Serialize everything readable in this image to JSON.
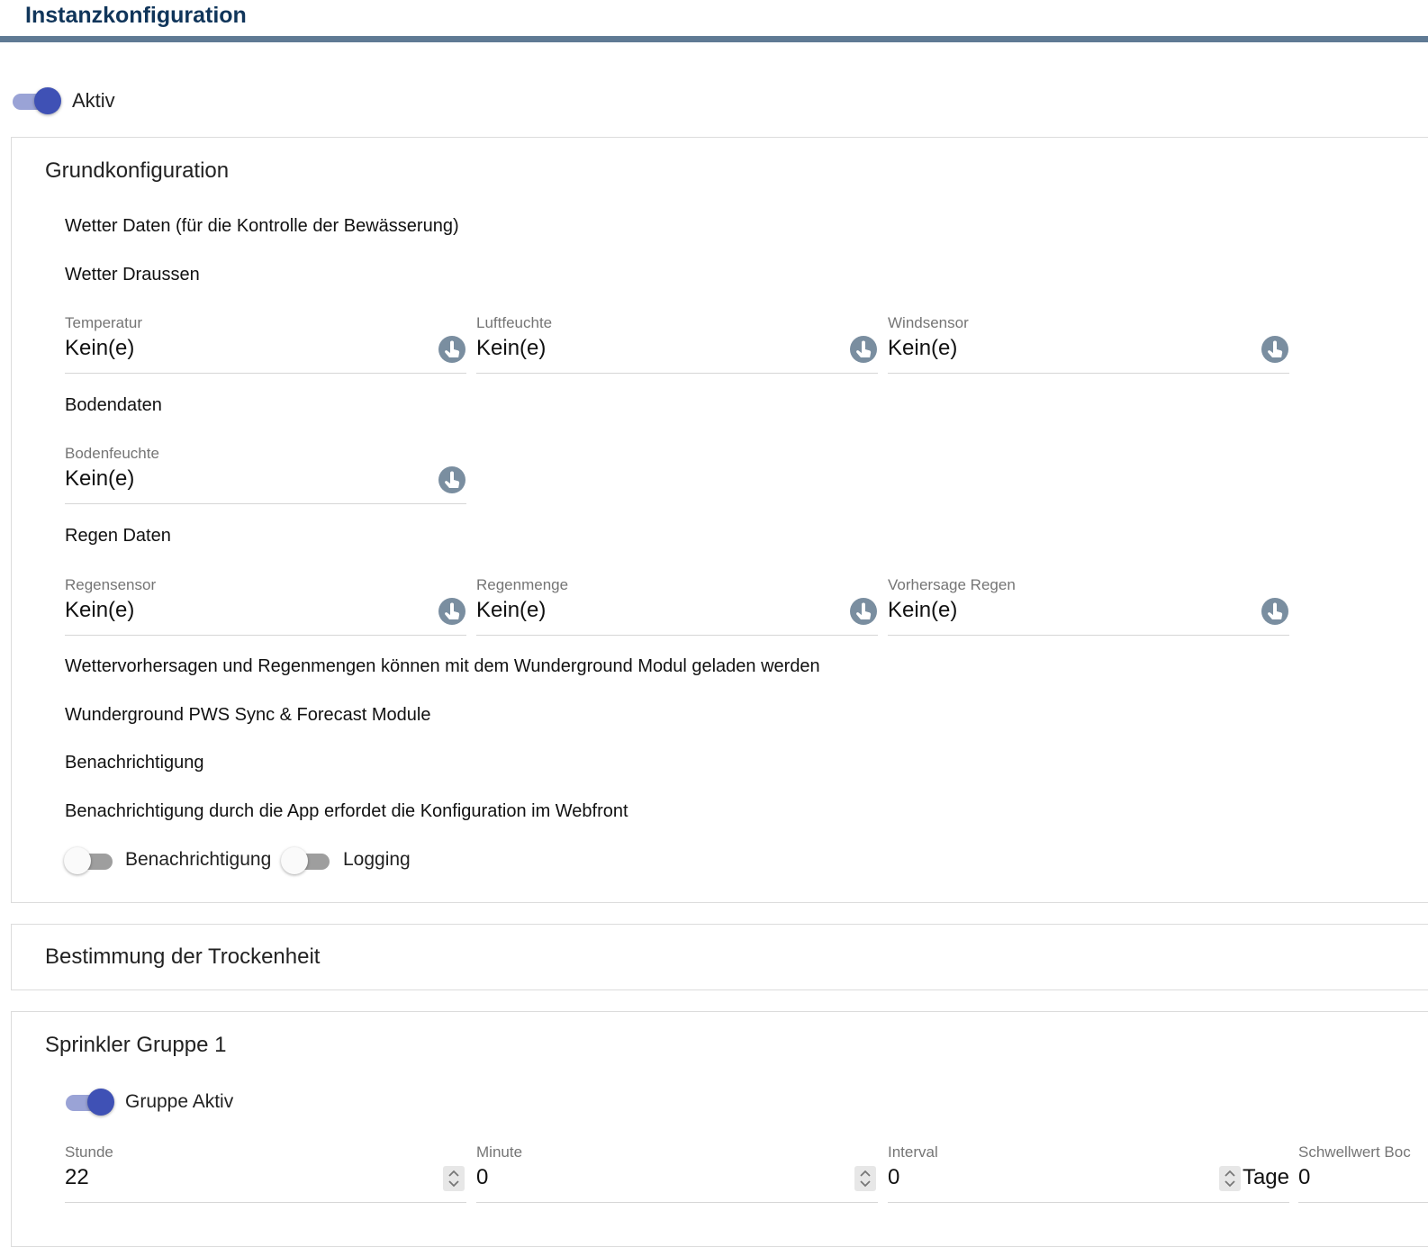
{
  "header": {
    "title": "Instanzkonfiguration"
  },
  "instance": {
    "active_label": "Aktiv",
    "active": true
  },
  "basic": {
    "title": "Grundkonfiguration",
    "weather_data_label": "Wetter Daten (für die Kontrolle der Bewässerung)",
    "weather_outside_label": "Wetter Draussen",
    "temperature": {
      "label": "Temperatur",
      "value": "Kein(e)"
    },
    "humidity": {
      "label": "Luftfeuchte",
      "value": "Kein(e)"
    },
    "wind": {
      "label": "Windsensor",
      "value": "Kein(e)"
    },
    "soil_data_label": "Bodendaten",
    "soil_moisture": {
      "label": "Bodenfeuchte",
      "value": "Kein(e)"
    },
    "rain_data_label": "Regen Daten",
    "rain_sensor": {
      "label": "Regensensor",
      "value": "Kein(e)"
    },
    "rain_amount": {
      "label": "Regenmenge",
      "value": "Kein(e)"
    },
    "rain_forecast": {
      "label": "Vorhersage Regen",
      "value": "Kein(e)"
    },
    "wunderground_hint": "Wettervorhersagen und Regenmengen können mit dem Wunderground Modul geladen werden",
    "wunderground_module": "Wunderground PWS Sync & Forecast Module",
    "notification_heading": "Benachrichtigung",
    "notification_hint": "Benachrichtigung durch die App erfordet die Konfiguration im Webfront",
    "notification_toggle_label": "Benachrichtigung",
    "notification_enabled": false,
    "logging_toggle_label": "Logging",
    "logging_enabled": false
  },
  "dryness": {
    "title": "Bestimmung der Trockenheit"
  },
  "group1": {
    "title": "Sprinkler Gruppe 1",
    "active_label": "Gruppe Aktiv",
    "active": true,
    "hour": {
      "label": "Stunde",
      "value": "22"
    },
    "minute": {
      "label": "Minute",
      "value": "0"
    },
    "interval": {
      "label": "Interval",
      "value": "0",
      "suffix": "Tage"
    },
    "threshold": {
      "label": "Schwellwert Boc",
      "value": "0"
    }
  },
  "colors": {
    "accent": "#3f51b5",
    "header_text": "#10355a",
    "header_rule": "#5f7a94",
    "select_icon": "#7a8ea0"
  },
  "icons": {
    "select": "pointer-hand-icon",
    "spinner": "spinner-arrows-icon"
  }
}
